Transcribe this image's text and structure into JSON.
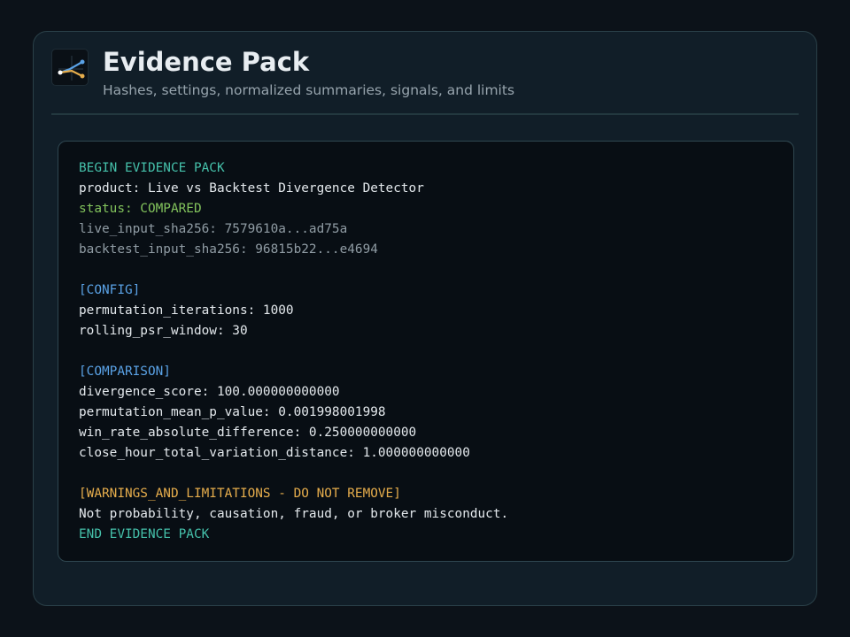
{
  "header": {
    "title": "Evidence Pack",
    "subtitle": "Hashes, settings, normalized summaries, signals, and limits",
    "logo_icon": "chart-line-icon"
  },
  "pack": {
    "begin": "BEGIN EVIDENCE PACK",
    "product": "product: Live vs Backtest Divergence Detector",
    "status": "status: COMPARED",
    "live_hash": "live_input_sha256: 7579610a...ad75a",
    "backtest_hash": "backtest_input_sha256: 96815b22...e4694",
    "config_header": "[CONFIG]",
    "config_lines": [
      "permutation_iterations: 1000",
      "rolling_psr_window: 30"
    ],
    "comparison_header": "[COMPARISON]",
    "comparison_lines": [
      "divergence_score: 100.000000000000",
      "permutation_mean_p_value: 0.001998001998",
      "win_rate_absolute_difference: 0.250000000000",
      "close_hour_total_variation_distance: 1.000000000000"
    ],
    "warnings_header": "[WARNINGS_AND_LIMITATIONS - DO NOT REMOVE]",
    "warning_text": "Not probability, causation, fraud, or broker misconduct.",
    "end": "END EVIDENCE PACK"
  },
  "colors": {
    "teal": "#45c0aa",
    "green": "#82c35c",
    "blue": "#5aa2e6",
    "amber": "#e6ad4c",
    "gray": "#909ca4"
  }
}
